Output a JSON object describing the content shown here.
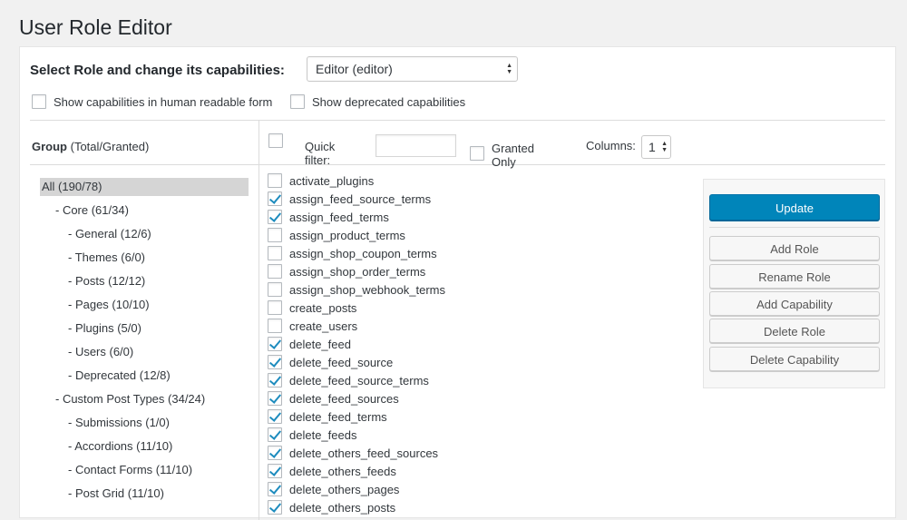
{
  "page_title": "User Role Editor",
  "role_selector": {
    "label": "Select Role and change its capabilities:",
    "selected": "Editor (editor)"
  },
  "options": {
    "human_readable": {
      "label": "Show capabilities in human readable form",
      "checked": false
    },
    "deprecated": {
      "label": "Show deprecated capabilities",
      "checked": false
    }
  },
  "groups_header": {
    "bold": "Group",
    "rest": "(Total/Granted)"
  },
  "filter_bar": {
    "select_all_checked": false,
    "quick_filter_label": "Quick filter:",
    "quick_filter_value": "",
    "granted_only_label": "Granted Only",
    "granted_only_checked": false,
    "columns_label": "Columns:",
    "columns_value": "1"
  },
  "groups": [
    {
      "label": "All (190/78)",
      "level": 0,
      "selected": true
    },
    {
      "label": "- Core (61/34)",
      "level": 1,
      "selected": false
    },
    {
      "label": "- General (12/6)",
      "level": 2,
      "selected": false
    },
    {
      "label": "- Themes (6/0)",
      "level": 2,
      "selected": false
    },
    {
      "label": "- Posts (12/12)",
      "level": 2,
      "selected": false
    },
    {
      "label": "- Pages (10/10)",
      "level": 2,
      "selected": false
    },
    {
      "label": "- Plugins (5/0)",
      "level": 2,
      "selected": false
    },
    {
      "label": "- Users (6/0)",
      "level": 2,
      "selected": false
    },
    {
      "label": "- Deprecated (12/8)",
      "level": 2,
      "selected": false
    },
    {
      "label": "- Custom Post Types (34/24)",
      "level": 1,
      "selected": false
    },
    {
      "label": "- Submissions (1/0)",
      "level": 2,
      "selected": false
    },
    {
      "label": "- Accordions (11/10)",
      "level": 2,
      "selected": false
    },
    {
      "label": "- Contact Forms (11/10)",
      "level": 2,
      "selected": false
    },
    {
      "label": "- Post Grid (11/10)",
      "level": 2,
      "selected": false
    }
  ],
  "capabilities": [
    {
      "name": "activate_plugins",
      "checked": false
    },
    {
      "name": "assign_feed_source_terms",
      "checked": true
    },
    {
      "name": "assign_feed_terms",
      "checked": true
    },
    {
      "name": "assign_product_terms",
      "checked": false
    },
    {
      "name": "assign_shop_coupon_terms",
      "checked": false
    },
    {
      "name": "assign_shop_order_terms",
      "checked": false
    },
    {
      "name": "assign_shop_webhook_terms",
      "checked": false
    },
    {
      "name": "create_posts",
      "checked": false
    },
    {
      "name": "create_users",
      "checked": false
    },
    {
      "name": "delete_feed",
      "checked": true
    },
    {
      "name": "delete_feed_source",
      "checked": true
    },
    {
      "name": "delete_feed_source_terms",
      "checked": true
    },
    {
      "name": "delete_feed_sources",
      "checked": true
    },
    {
      "name": "delete_feed_terms",
      "checked": true
    },
    {
      "name": "delete_feeds",
      "checked": true
    },
    {
      "name": "delete_others_feed_sources",
      "checked": true
    },
    {
      "name": "delete_others_feeds",
      "checked": true
    },
    {
      "name": "delete_others_pages",
      "checked": true
    },
    {
      "name": "delete_others_posts",
      "checked": true
    }
  ],
  "actions": {
    "update": "Update",
    "add_role": "Add Role",
    "rename_role": "Rename Role",
    "add_capability": "Add Capability",
    "delete_role": "Delete Role",
    "delete_capability": "Delete Capability"
  },
  "colors": {
    "primary_button": "#0085ba",
    "checkmark": "#1e8cbe",
    "selected_group_bg": "#d5d5d5"
  }
}
